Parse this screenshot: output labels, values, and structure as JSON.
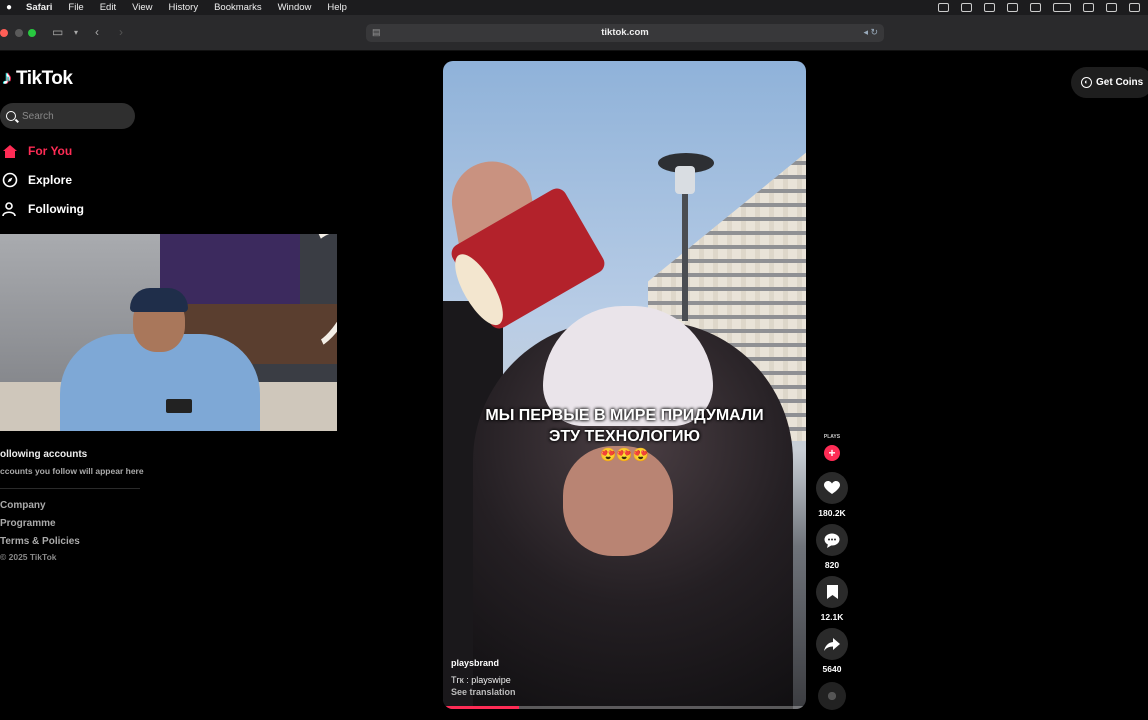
{
  "menubar": {
    "app": "Safari",
    "items": [
      "File",
      "Edit",
      "View",
      "History",
      "Bookmarks",
      "Window",
      "Help"
    ]
  },
  "browser": {
    "url": "tiktok.com"
  },
  "sidebar": {
    "brand": "TikTok",
    "search_placeholder": "Search",
    "nav": [
      {
        "label": "For You",
        "icon": "home-icon",
        "active": true
      },
      {
        "label": "Explore",
        "icon": "compass-icon",
        "active": false
      },
      {
        "label": "Following",
        "icon": "following-icon",
        "active": false
      }
    ],
    "following_title": "ollowing accounts",
    "following_sub": "ccounts you follow will appear here",
    "footer": [
      "Company",
      "Programme",
      "Terms & Policies"
    ],
    "copyright": "© 2025 TikTok"
  },
  "header": {
    "coins_label": "Get Coins"
  },
  "video": {
    "caption_line1": "МЫ ПЕРВЫЕ В МИРЕ ПРИДУМАЛИ",
    "caption_line2": "ЭТУ ТЕХНОЛОГИЮ",
    "emoji": "😍😍😍",
    "author": "playsbrand",
    "description": "Тгк : playswipe",
    "translate_label": "See translation",
    "progress": 0.21
  },
  "actions": {
    "avatar_text": "PLAYS",
    "likes": "180.2K",
    "comments": "820",
    "saves": "12.1K",
    "shares": "5640"
  },
  "colors": {
    "accent": "#fe2c55",
    "background": "#000000"
  }
}
